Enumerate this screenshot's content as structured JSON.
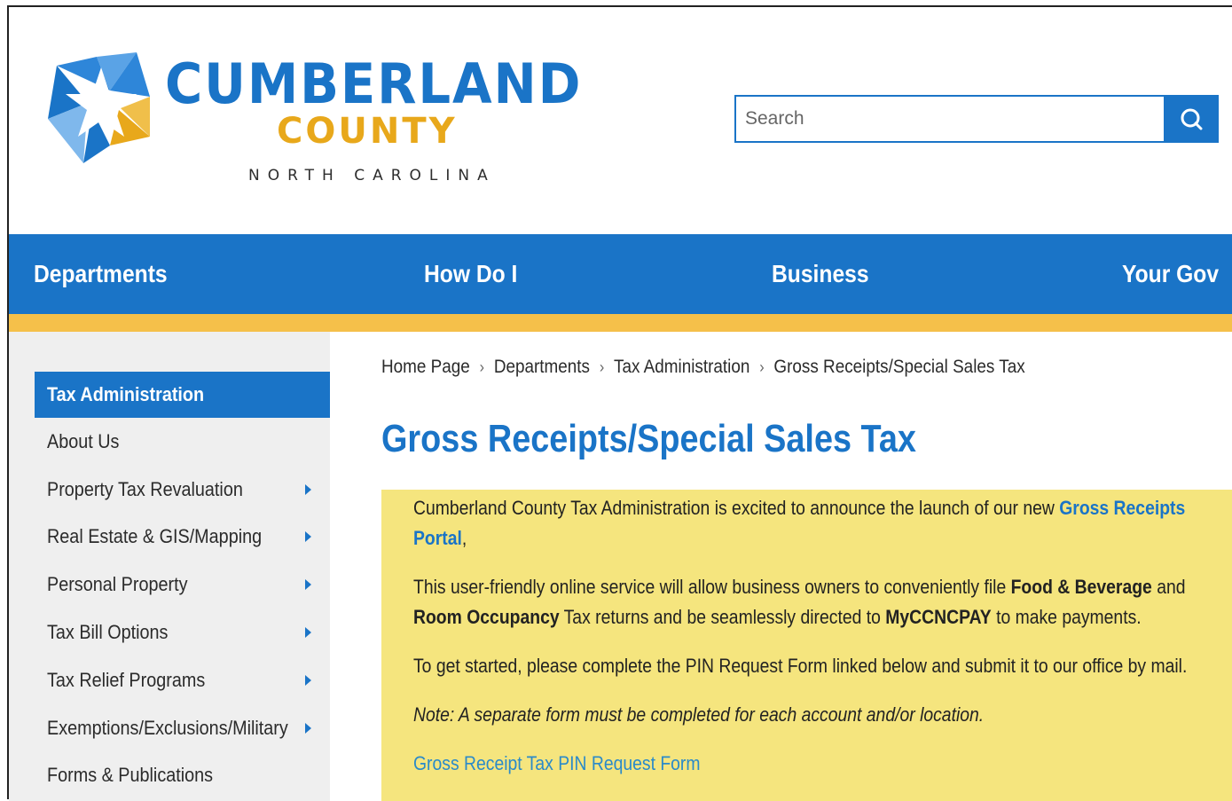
{
  "header": {
    "logo": {
      "word1": "CUMBERLAND",
      "word2": "COUNTY",
      "word3": "NORTH CAROLINA"
    },
    "search": {
      "placeholder": "Search",
      "value": ""
    }
  },
  "nav": {
    "items": [
      "Departments",
      "How Do I",
      "Business",
      "Your Gov"
    ]
  },
  "sidebar": {
    "heading": "Tax Administration",
    "items": [
      {
        "label": "About Us",
        "has_submenu": false
      },
      {
        "label": "Property Tax Revaluation",
        "has_submenu": true
      },
      {
        "label": "Real Estate & GIS/Mapping",
        "has_submenu": true
      },
      {
        "label": "Personal Property",
        "has_submenu": true
      },
      {
        "label": "Tax Bill Options",
        "has_submenu": true
      },
      {
        "label": "Tax Relief Programs",
        "has_submenu": true
      },
      {
        "label": "Exemptions/Exclusions/Military",
        "has_submenu": true
      },
      {
        "label": "Forms & Publications",
        "has_submenu": false
      }
    ]
  },
  "breadcrumb": [
    "Home Page",
    "Departments",
    "Tax Administration",
    "Gross Receipts/Special Sales Tax"
  ],
  "page_title": "Gross Receipts/Special Sales Tax",
  "notice": {
    "p1_text": "Cumberland County Tax Administration is excited to announce the launch of our new ",
    "p1_link": "Gross Receipts Portal",
    "p1_end": ",",
    "p2_a": "This user-friendly online service will allow business owners to conveniently file ",
    "p2_b": "Food & Beverage",
    "p2_c": " and ",
    "p2_d": "Room Occupancy",
    "p2_e": " Tax returns and be seamlessly directed to ",
    "p2_f": "MyCCNCPAY",
    "p2_g": " to make payments.",
    "p3": "To get started, please complete the PIN Request Form linked below and submit it to our office by mail.",
    "p4": "Note: A separate form must be completed for each account and/or location.",
    "p5_link": "Gross Receipt Tax PIN Request Form"
  },
  "colors": {
    "brand_blue": "#1a74c7",
    "gold": "#f5c04a",
    "notice_yellow": "#f5e57e",
    "sidebar_gray": "#efefef"
  }
}
